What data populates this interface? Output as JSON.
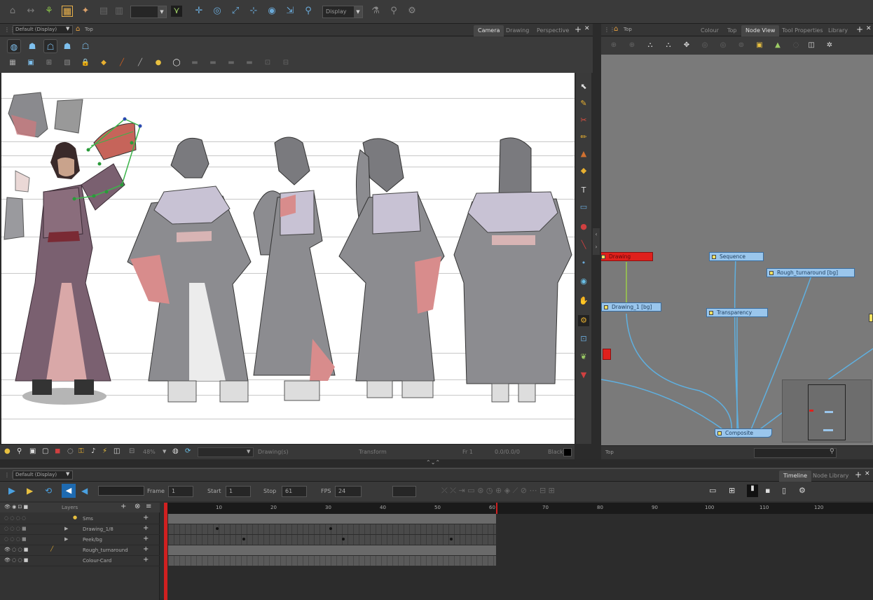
{
  "toolbar": {
    "combo_left": "",
    "combo_display": "Display",
    "icons": [
      "select-icon",
      "transform-icon",
      "stage-icon",
      "grid-icon",
      "magic-icon",
      "animate-icon",
      "mode-icon",
      "deformer-icon",
      "camera-icon",
      "brush-icon",
      "move-icon",
      "rotate-icon",
      "scale-icon",
      "skew-icon",
      "maximize-icon",
      "flip-icon",
      "gear-icon"
    ]
  },
  "camera_view": {
    "view_selector": "Default (Display)",
    "breadcrumb": "Top",
    "tabs": [
      "Camera",
      "Drawing",
      "Perspective"
    ],
    "active_tab": "Camera",
    "status": {
      "zoom": "48%",
      "drawing_label": "Drawing(s)",
      "mode": "Transform",
      "frame": "Fr 1",
      "coords": "0.0/0.0/0",
      "color": "Black"
    }
  },
  "node_view": {
    "breadcrumb": "Top",
    "tabs": [
      "Colour",
      "Top",
      "Node View",
      "Tool Properties",
      "Library"
    ],
    "active_tab": "Node View",
    "nodes": {
      "drawing_red": "Drawing",
      "drawing_bg": "Drawing_1 [bg]",
      "sequence": "Sequence",
      "transparency": "Transparency",
      "rough": "Rough_turnaround [bg]",
      "composite": "Composite"
    },
    "footer": "Top"
  },
  "timeline": {
    "view_selector": "Default (Display)",
    "tabs": [
      "Timeline",
      "Node Library"
    ],
    "active_tab": "Timeline",
    "frame_label": "Frame",
    "frame_value": "1",
    "start_label": "Start",
    "start_value": "1",
    "stop_label": "Stop",
    "stop_value": "61",
    "fps_label": "FPS",
    "fps_value": "24",
    "layers_header": "Layers",
    "layers": [
      "Sms",
      "Drawing_1/8",
      "Peek/bg",
      "Rough_turnaround",
      "Colour-Card"
    ],
    "ruler": [
      "10",
      "20",
      "30",
      "40",
      "50",
      "60",
      "70",
      "80",
      "90",
      "100",
      "110",
      "120"
    ]
  }
}
